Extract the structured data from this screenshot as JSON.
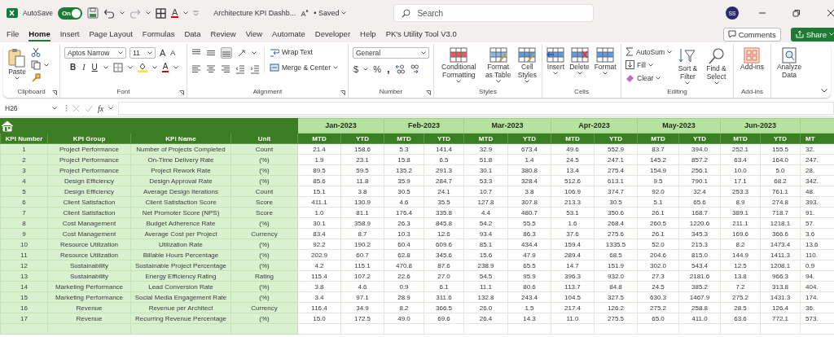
{
  "title_bar": {
    "autosave_label": "AutoSave",
    "autosave_on": true,
    "toggle_text": "On",
    "font_color_glyph": "A",
    "document_title": "Architecture KPI Dashb...",
    "saved_status": "• Saved",
    "search_placeholder": "Search",
    "user_initials": "SS"
  },
  "menu_tabs": [
    {
      "label": "File",
      "selected": false
    },
    {
      "label": "Home",
      "selected": true
    },
    {
      "label": "Insert",
      "selected": false
    },
    {
      "label": "Page Layout",
      "selected": false
    },
    {
      "label": "Formulas",
      "selected": false
    },
    {
      "label": "Data",
      "selected": false
    },
    {
      "label": "Review",
      "selected": false
    },
    {
      "label": "View",
      "selected": false
    },
    {
      "label": "Automate",
      "selected": false
    },
    {
      "label": "Developer",
      "selected": false
    },
    {
      "label": "Help",
      "selected": false
    },
    {
      "label": "PK's Utility Tool V3.0",
      "selected": false
    }
  ],
  "comments_button": "Comments",
  "share_button": "Share",
  "ribbon": {
    "clipboard": {
      "label": "Clipboard",
      "paste": "Paste"
    },
    "font": {
      "label": "Font",
      "font_name": "Aptos Narrow",
      "font_size": "11",
      "grow": "A",
      "shrink": "A",
      "bold": "B",
      "italic": "I",
      "underline": "U",
      "font_color": "A"
    },
    "alignment": {
      "label": "Alignment",
      "wrap_text": "Wrap Text",
      "merge_center": "Merge & Center"
    },
    "number": {
      "label": "Number",
      "format": "General",
      "currency": "$",
      "percent": "%",
      "comma": ","
    },
    "styles": {
      "label": "Styles",
      "items": [
        "Conditional Formatting",
        "Format as Table",
        "Cell Styles"
      ]
    },
    "cells": {
      "label": "Cells",
      "items": [
        "Insert",
        "Delete",
        "Format"
      ]
    },
    "editing": {
      "label": "Editing",
      "autosum": "AutoSum",
      "fill": "Fill",
      "clear": "Clear",
      "sort_filter": "Sort & Filter",
      "find_select": "Find & Select"
    },
    "add_ins": {
      "label": "Add-ins",
      "button": "Add-ins"
    },
    "analyze": {
      "button": "Analyze Data"
    }
  },
  "formula_bar": {
    "cell_ref": "H26",
    "fx": "fx"
  },
  "sheet": {
    "columns": [
      "KPI Number",
      "KPI Group",
      "KPI Name",
      "Unit"
    ],
    "months": [
      {
        "label": "Jan-2023",
        "sub_columns": [
          "MTD",
          "YTD"
        ]
      },
      {
        "label": "Feb-2023",
        "sub_columns": [
          "MTD",
          "YTD"
        ]
      },
      {
        "label": "Mar-2023",
        "sub_columns": [
          "MTD",
          "YTD"
        ]
      },
      {
        "label": "Apr-2023",
        "sub_columns": [
          "MTD",
          "YTD"
        ]
      },
      {
        "label": "May-2023",
        "sub_columns": [
          "MTD",
          "YTD"
        ]
      },
      {
        "label": "Jun-2023",
        "sub_columns": [
          "MTD",
          "YTD"
        ]
      }
    ],
    "cut_column_header": "MT",
    "rows": [
      {
        "number": "1",
        "group": "Project Performance",
        "name": "Number of Projects Completed",
        "unit": "Count",
        "values": [
          "21.4",
          "158.6",
          "5.3",
          "141.4",
          "32.9",
          "673.4",
          "49.6",
          "552.9",
          "83.7",
          "394.0",
          "252.1",
          "155.5"
        ],
        "cut_value": "32."
      },
      {
        "number": "2",
        "group": "Project Performance",
        "name": "On-Time Delivery Rate",
        "unit": "(%)",
        "values": [
          "1.9",
          "23.1",
          "15.8",
          "6.5",
          "51.8",
          "1.4",
          "24.5",
          "247.1",
          "145.2",
          "857.2",
          "63.4",
          "164.0"
        ],
        "cut_value": "247."
      },
      {
        "number": "3",
        "group": "Project Performance",
        "name": "Project Rework Rate",
        "unit": "(%)",
        "values": [
          "89.5",
          "59.5",
          "135.2",
          "291.3",
          "30.1",
          "380.8",
          "13.4",
          "275.4",
          "154.9",
          "256.1",
          "10.0",
          "5.0"
        ],
        "cut_value": "28."
      },
      {
        "number": "4",
        "group": "Design Efficiency",
        "name": "Design Approval Rate",
        "unit": "(%)",
        "values": [
          "85.6",
          "11.8",
          "35.9",
          "284.7",
          "53.3",
          "328.4",
          "512.6",
          "613.1",
          "9.5",
          "790.1",
          "17.1",
          "68.2"
        ],
        "cut_value": "342."
      },
      {
        "number": "5",
        "group": "Design Efficiency",
        "name": "Average Design Iterations",
        "unit": "Count",
        "values": [
          "15.1",
          "3.8",
          "30.5",
          "24.1",
          "10.7",
          "3.8",
          "106.9",
          "374.7",
          "92.0",
          "32.4",
          "253.3",
          "761.1"
        ],
        "cut_value": "48."
      },
      {
        "number": "6",
        "group": "Client Satisfaction",
        "name": "Client Satisfaction Score",
        "unit": "Score",
        "values": [
          "411.1",
          "130.9",
          "4.6",
          "35.5",
          "127.8",
          "307.8",
          "213.3",
          "30.5",
          "5.1",
          "65.6",
          "8.9",
          "274.8"
        ],
        "cut_value": "393."
      },
      {
        "number": "7",
        "group": "Client Satisfaction",
        "name": "Net Promoter Score (NPS)",
        "unit": "Score",
        "values": [
          "1.0",
          "81.1",
          "176.4",
          "335.8",
          "4.4",
          "480.7",
          "53.1",
          "350.6",
          "26.1",
          "168.7",
          "389.1",
          "718.7"
        ],
        "cut_value": "91."
      },
      {
        "number": "8",
        "group": "Cost Management",
        "name": "Budget Adherence Rate",
        "unit": "(%)",
        "values": [
          "30.1",
          "358.9",
          "26.3",
          "845.8",
          "54.2",
          "55.5",
          "1.6",
          "268.4",
          "260.5",
          "1220.6",
          "211.1",
          "1218.1"
        ],
        "cut_value": "57."
      },
      {
        "number": "9",
        "group": "Cost Management",
        "name": "Average Cost per Project",
        "unit": "Currency",
        "values": [
          "83.4",
          "8.7",
          "10.3",
          "12.6",
          "93.4",
          "86.3",
          "37.6",
          "275.6",
          "26.1",
          "345.3",
          "169.6",
          "366.6"
        ],
        "cut_value": "3.6"
      },
      {
        "number": "10",
        "group": "Resource Utilization",
        "name": "Utilization Rate",
        "unit": "(%)",
        "values": [
          "92.2",
          "190.2",
          "60.4",
          "609.6",
          "85.1",
          "434.4",
          "159.4",
          "1335.5",
          "52.0",
          "215.3",
          "8.2",
          "1473.4"
        ],
        "cut_value": "13.6"
      },
      {
        "number": "11",
        "group": "Resource Utilization",
        "name": "Billable Hours Percentage",
        "unit": "(%)",
        "values": [
          "202.9",
          "60.7",
          "62.8",
          "345.6",
          "15.6",
          "47.9",
          "289.4",
          "68.5",
          "204.6",
          "815.0",
          "144.9",
          "1411.3"
        ],
        "cut_value": "110."
      },
      {
        "number": "12",
        "group": "Sustainability",
        "name": "Sustainable Project Percentage",
        "unit": "(%)",
        "values": [
          "4.2",
          "115.1",
          "470.8",
          "87.6",
          "238.9",
          "65.5",
          "14.7",
          "151.9",
          "302.0",
          "543.4",
          "12.5",
          "1208.1"
        ],
        "cut_value": "0.9"
      },
      {
        "number": "13",
        "group": "Sustainability",
        "name": "Energy Efficiency Rating",
        "unit": "Rating",
        "values": [
          "115.4",
          "107.2",
          "22.6",
          "27.0",
          "54.5",
          "95.9",
          "396.3",
          "932.0",
          "27.3",
          "2181.6",
          "13.8",
          "966.3"
        ],
        "cut_value": "94."
      },
      {
        "number": "14",
        "group": "Marketing Performance",
        "name": "Lead Conversion Rate",
        "unit": "(%)",
        "values": [
          "3.8",
          "4.6",
          "0.9",
          "6.1",
          "11.1",
          "80.6",
          "113.7",
          "84.8",
          "24.5",
          "385.2",
          "7.2",
          "313.8"
        ],
        "cut_value": "404."
      },
      {
        "number": "15",
        "group": "Marketing Performance",
        "name": "Social Media Engagement Rate",
        "unit": "(%)",
        "values": [
          "3.4",
          "97.1",
          "28.9",
          "311.6",
          "132.8",
          "243.4",
          "104.5",
          "327.5",
          "630.3",
          "1467.9",
          "275.2",
          "1431.3"
        ],
        "cut_value": "174."
      },
      {
        "number": "16",
        "group": "Revenue",
        "name": "Revenue per Architect",
        "unit": "Currency",
        "values": [
          "116.4",
          "34.9",
          "8.2",
          "366.5",
          "26.0",
          "1.5",
          "217.4",
          "126.2",
          "275.2",
          "258.8",
          "28.5",
          "126.4"
        ],
        "cut_value": "36."
      },
      {
        "number": "17",
        "group": "Revenue",
        "name": "Recurring Revenue Percentage",
        "unit": "(%)",
        "values": [
          "15.0",
          "172.5",
          "49.0",
          "69.6",
          "26.4",
          "14.3",
          "11.0",
          "275.5",
          "65.0",
          "411.0",
          "63.6",
          "772.1"
        ],
        "cut_value": "573."
      }
    ]
  }
}
